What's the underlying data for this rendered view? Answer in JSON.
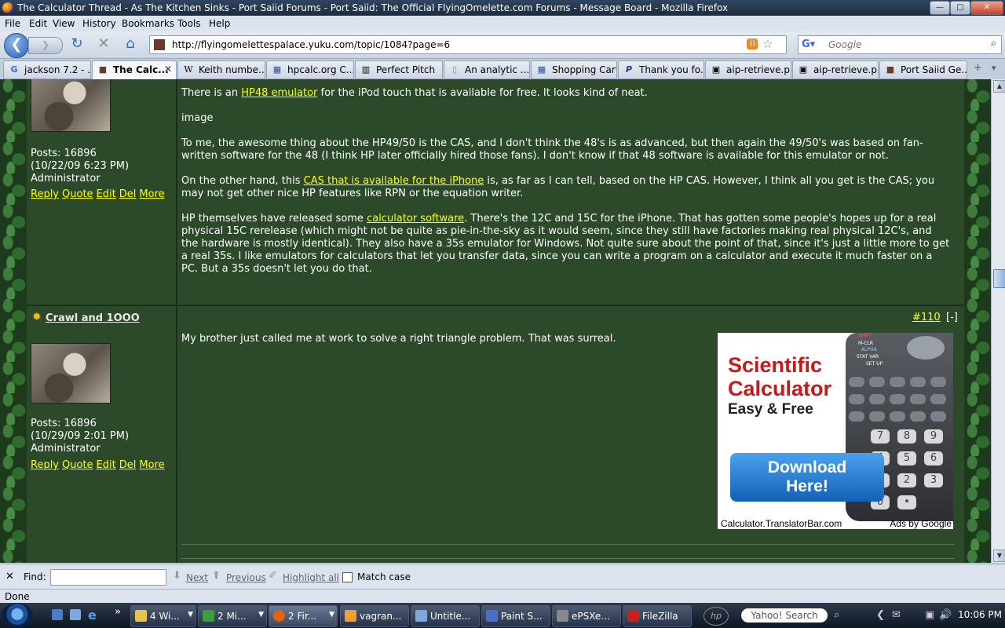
{
  "window": {
    "title": "The Calculator Thread - As The Kitchen Sinks - Port Saiid Forums - Port Saiid: The Official FlyingOmelette.com Forums - Message Board - Mozilla Firefox",
    "controls": {
      "minimize": "—",
      "maximize": "□",
      "close": "✕"
    }
  },
  "menu": [
    "File",
    "Edit",
    "View",
    "History",
    "Bookmarks",
    "Tools",
    "Help"
  ],
  "nav": {
    "url": "http://flyingomelettespalace.yuku.com/topic/1084?page=6",
    "search_placeholder": "Google",
    "back_glyph": "❮",
    "forward_glyph": "❯",
    "reload_glyph": "↻",
    "stop_glyph": "✕",
    "home_glyph": "⌂",
    "rss_glyph": "))",
    "star_glyph": "☆",
    "search_glyph": "⌕"
  },
  "tabs": [
    {
      "label": "jackson 7.2 - ...",
      "icon": "google-icon",
      "glyph": "G",
      "color": "#3369e8"
    },
    {
      "label": "The Calc...",
      "icon": "forum-icon",
      "glyph": "■",
      "color": "#6b3b2a",
      "active": true
    },
    {
      "label": "Keith numbe...",
      "icon": "wikipedia-icon",
      "glyph": "W",
      "color": "#222"
    },
    {
      "label": "hpcalc.org C...",
      "icon": "calculator-icon",
      "glyph": "▦",
      "color": "#2a4f9c"
    },
    {
      "label": "Perfect Pitch",
      "icon": "piano-icon",
      "glyph": "▥",
      "color": "#222"
    },
    {
      "label": "An analytic ...",
      "icon": "page-icon",
      "glyph": "▯",
      "color": "#888"
    },
    {
      "label": "Shopping Cart",
      "icon": "calculator-icon",
      "glyph": "▦",
      "color": "#2a4f9c"
    },
    {
      "label": "Thank you fo...",
      "icon": "paypal-icon",
      "glyph": "P",
      "color": "#1b3e8f"
    },
    {
      "label": "aip-retrieve.p...",
      "icon": "page-icon",
      "glyph": "▣",
      "color": "#335"
    },
    {
      "label": "aip-retrieve.p...",
      "icon": "page-icon",
      "glyph": "▣",
      "color": "#335"
    },
    {
      "label": "Port Saiid Ge...",
      "icon": "forum-icon",
      "glyph": "■",
      "color": "#6b3b2a"
    }
  ],
  "tab_controls": {
    "new_tab": "+",
    "list_tabs": "▾",
    "close_tab": "✕"
  },
  "post1": {
    "meta": {
      "posts": "Posts: 16896",
      "date": "(10/22/09 6:23 PM)",
      "role": "Administrator"
    },
    "actions": [
      "Reply",
      "Quote",
      "Edit",
      "Del",
      "More"
    ],
    "p1_pre": "There is an ",
    "p1_link": "HP48 emulator",
    "p1_post": " for the iPod touch that is available for free. It looks kind of neat.",
    "p2": "image",
    "p3": "To me, the awesome thing about the HP49/50 is the CAS, and I don't think the 48's is as advanced, but then again the 49/50's was based on fan-written software for the 48 (I think HP later officially hired those fans). I don't know if that 48 software is available for this emulator or not.",
    "p4_pre": "On the other hand, this ",
    "p4_link": "CAS that is available for the iPhone",
    "p4_post": " is, as far as I can tell, based on the HP CAS. However, I think all you get is the CAS; you may not get other nice HP features like RPN or the equation writer.",
    "p5_pre": "HP themselves have released some ",
    "p5_link": "calculator software",
    "p5_post": ". There's the 12C and 15C for the iPhone. That has gotten some people's hopes up for a real physical 15C rerelease (which might not be quite as pie-in-the-sky as it would seem, since they still have factories making real physical 12C's, and the hardware is mostly identical). They also have a 35s emulator for Windows. Not quite sure about the point of that, since it's just a little more to get a real 35s. I like emulators for calculators that let you transfer data, since you can write a program on a calculator and execute it much faster on a PC. But a 35s doesn't let you do that."
  },
  "post2": {
    "username": "Crawl and 1OOO",
    "user_glyph": "✹",
    "post_number": "#110",
    "collapse": "[-]",
    "meta": {
      "posts": "Posts: 16896",
      "date": "(10/29/09 2:01 PM)",
      "role": "Administrator"
    },
    "actions": [
      "Reply",
      "Quote",
      "Edit",
      "Del",
      "More"
    ],
    "body": "My brother just called me at work to solve a right triangle problem. That was surreal."
  },
  "ad": {
    "headline1": "Scientific",
    "headline2": "Calculator",
    "subhead": "Easy & Free",
    "button_line1": "Download",
    "button_line2": "Here!",
    "footer": "Calculator.TranslatorBar.com",
    "adsby": "Ads by Google",
    "keys": [
      "7",
      "8",
      "9",
      "4",
      "5",
      "6",
      "1",
      "2",
      "3",
      "0",
      "•"
    ],
    "text_keys": {
      "shift": "SHIFT",
      "mclr": "M-CLR",
      "alpha": "ALPHA",
      "statvar": "STAT VAR",
      "setup": "SET UP"
    }
  },
  "scrollbar": {
    "up": "▲",
    "down": "▼"
  },
  "findbar": {
    "close": "✕",
    "label": "Find:",
    "next": "Next",
    "previous": "Previous",
    "highlight": "Highlight all",
    "match_case": "Match case",
    "next_glyph": "⬇",
    "previous_glyph": "⬆",
    "highlight_glyph": "✐"
  },
  "status": "Done",
  "taskbar": {
    "items": [
      {
        "label": "4 Wi...",
        "color": "#e8c24a"
      },
      {
        "label": "2 Mi...",
        "color": "#3b9d3b"
      },
      {
        "label": "2 Fir...",
        "color": "#e2620d",
        "active": true
      },
      {
        "label": "vagran...",
        "color": "#f0a030"
      },
      {
        "label": "Untitle...",
        "color": "#7aa8e0"
      },
      {
        "label": "Paint S...",
        "color": "#4a6fc8"
      },
      {
        "label": "ePSXe...",
        "color": "#888"
      },
      {
        "label": "FileZilla",
        "color": "#c8201a"
      }
    ],
    "quicklaunch_more": "»",
    "hp_logo": "hp",
    "search": "Yahoo! Search",
    "tray": [
      "⌕",
      "❮",
      "✉",
      "▣",
      "🔊"
    ],
    "clock": "10:06 PM"
  }
}
